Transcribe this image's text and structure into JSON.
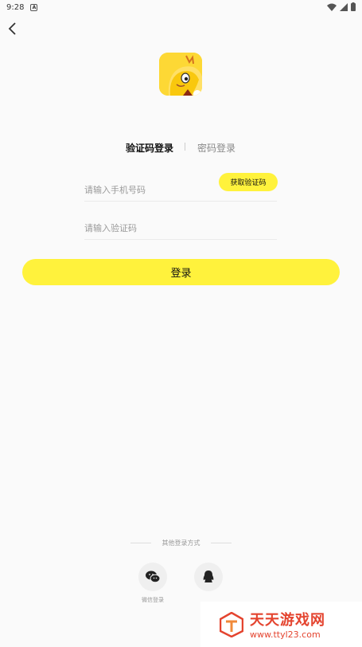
{
  "status_bar": {
    "time": "9:28",
    "notification_icon": "A"
  },
  "logo": {
    "name": "app-logo-dragon"
  },
  "tabs": {
    "sms_login": "验证码登录",
    "password_login": "密码登录"
  },
  "form": {
    "phone_placeholder": "请输入手机号码",
    "code_placeholder": "请输入验证码",
    "get_code": "获取验证码",
    "login": "登录"
  },
  "other": {
    "title": "其他登录方式",
    "wechat_label": "微信登录",
    "qq_label": ""
  },
  "watermark": {
    "title": "天天游戏网",
    "url": "www.ttyl23.com"
  },
  "colors": {
    "accent": "#fff23c",
    "background": "#fafafa",
    "watermark": "#e4442f"
  }
}
